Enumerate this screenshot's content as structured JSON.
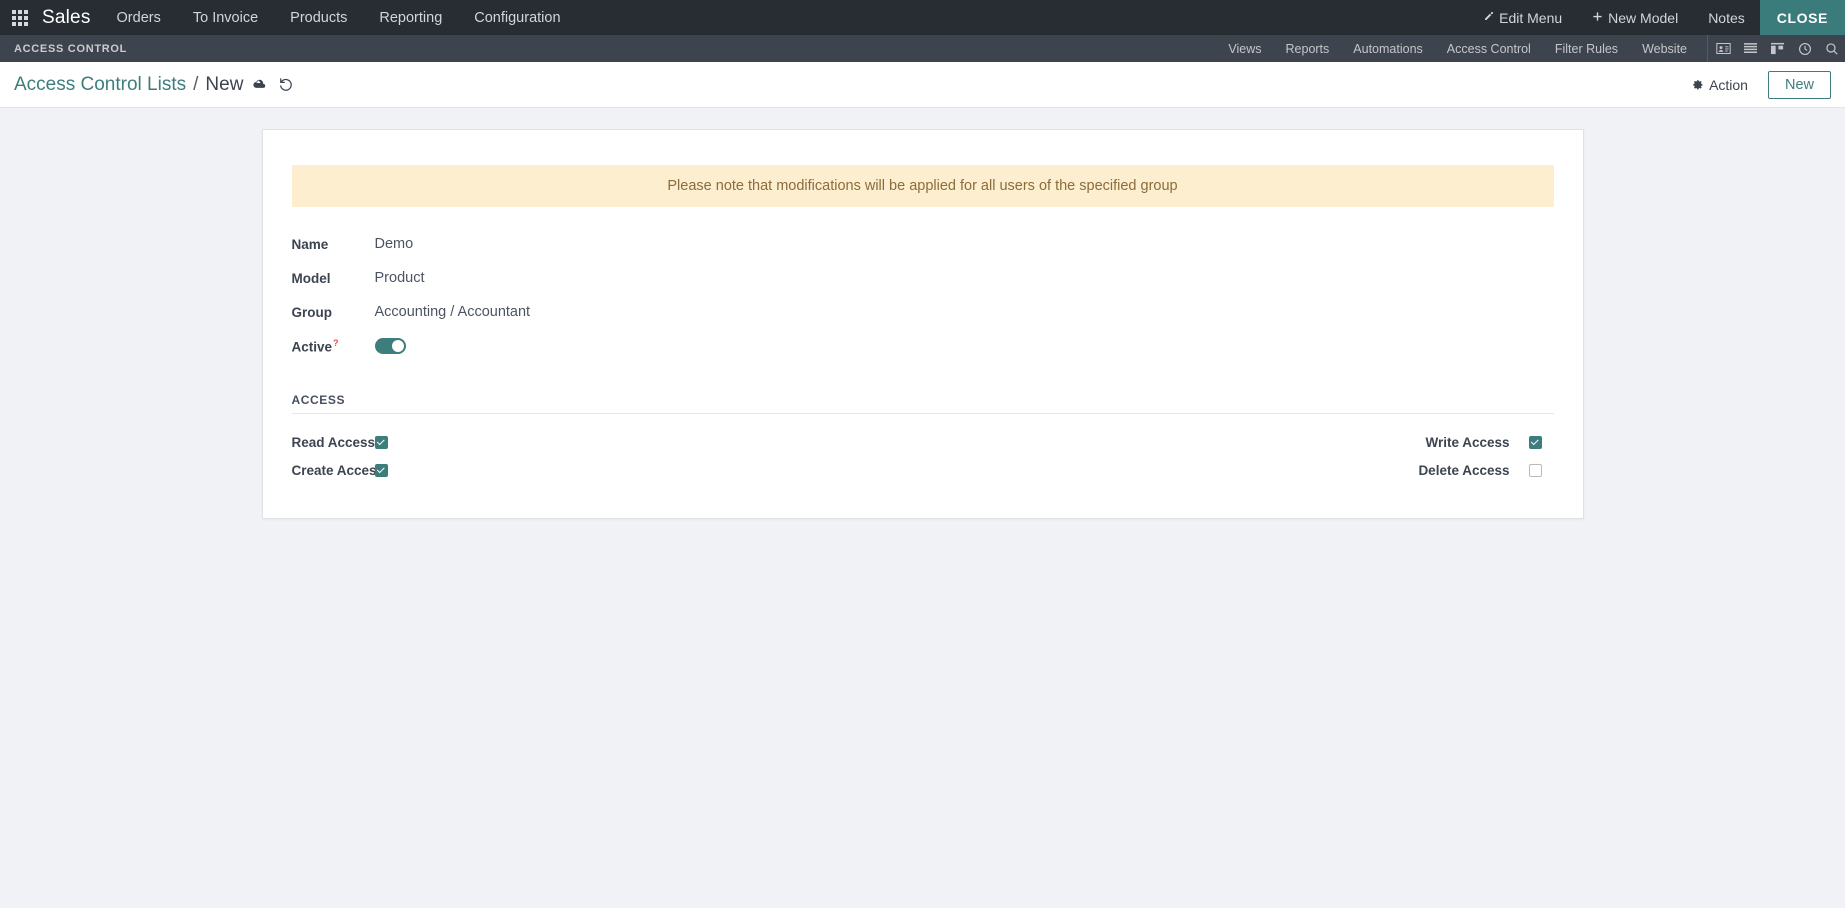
{
  "navbar": {
    "apps_icon": "apps-grid-icon",
    "brand": "Sales",
    "menu": [
      {
        "label": "Orders"
      },
      {
        "label": "To Invoice"
      },
      {
        "label": "Products"
      },
      {
        "label": "Reporting"
      },
      {
        "label": "Configuration"
      }
    ],
    "right": [
      {
        "label": "Edit Menu",
        "icon": "pencil-icon"
      },
      {
        "label": "New Model",
        "icon": "plus-icon"
      },
      {
        "label": "Notes",
        "icon": null
      }
    ],
    "close_label": "CLOSE",
    "close_bg": "#3a7c7b"
  },
  "subbar": {
    "title": "ACCESS CONTROL",
    "items": [
      {
        "label": "Views"
      },
      {
        "label": "Reports"
      },
      {
        "label": "Automations"
      },
      {
        "label": "Access Control"
      },
      {
        "label": "Filter Rules"
      },
      {
        "label": "Website"
      }
    ],
    "icons": [
      {
        "name": "contact-card-icon"
      },
      {
        "name": "list-view-icon"
      },
      {
        "name": "kanban-view-icon"
      },
      {
        "name": "activity-clock-icon"
      },
      {
        "name": "search-icon"
      }
    ]
  },
  "control_panel": {
    "breadcrumb_parent": "Access Control Lists",
    "breadcrumb_separator": "/",
    "breadcrumb_current": "New",
    "save_icon": "cloud-upload-icon",
    "discard_icon": "undo-icon",
    "action_label": "Action",
    "action_icon": "gear-icon",
    "new_label": "New",
    "accent_color": "#3d7e7c"
  },
  "form": {
    "alert_text": "Please note that modifications will be applied for all users of the specified group",
    "alert_bg": "#fceecf",
    "alert_color": "#8a6d3b",
    "fields": [
      {
        "label": "Name",
        "value": "Demo"
      },
      {
        "label": "Model",
        "value": "Product"
      },
      {
        "label": "Group",
        "value": "Accounting / Accountant"
      }
    ],
    "active": {
      "label": "Active",
      "help_marker": "?",
      "checked": true
    },
    "group_title": "ACCESS",
    "access_left": [
      {
        "label": "Read Access",
        "checked": true
      },
      {
        "label": "Create Access",
        "checked": true
      }
    ],
    "access_right": [
      {
        "label": "Write Access",
        "checked": true
      },
      {
        "label": "Delete Access",
        "checked": false
      }
    ]
  }
}
